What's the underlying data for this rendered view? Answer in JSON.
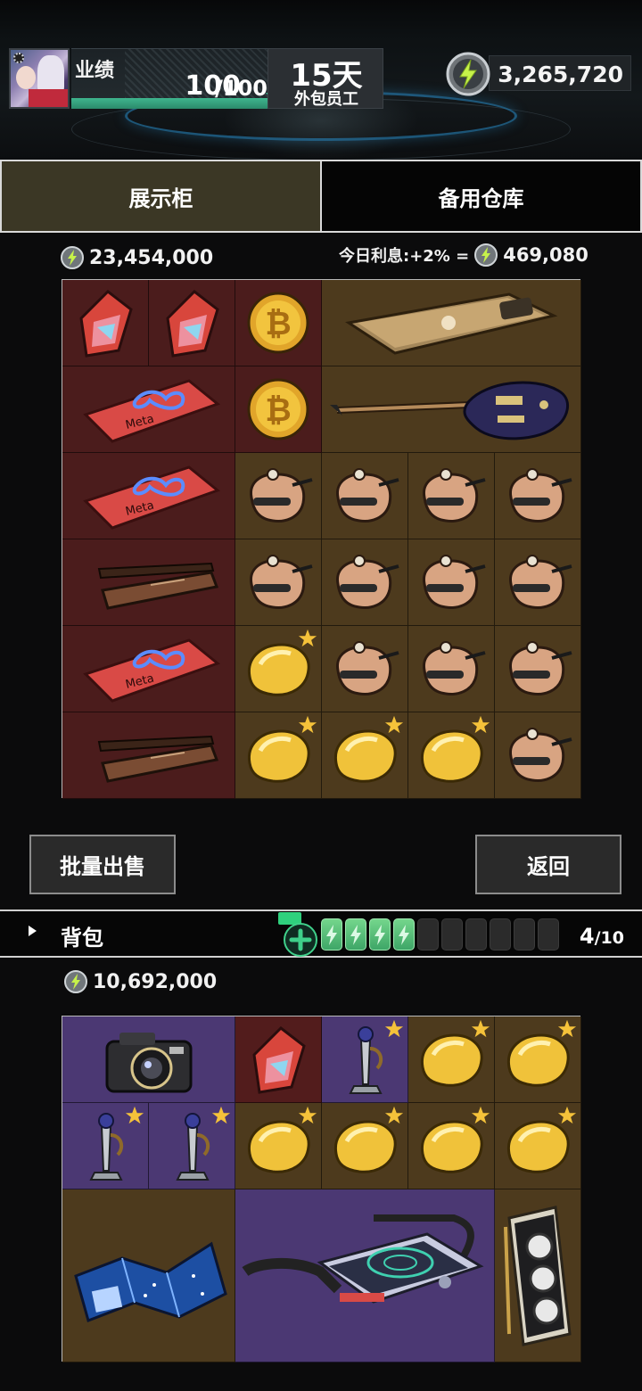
{
  "hud": {
    "performance_label": "业绩",
    "performance_value": "100",
    "performance_max": "/100",
    "performance_fraction": 1.0,
    "day_value": "15天",
    "day_sub": "外包员工",
    "money": "3,265,720"
  },
  "tabs": {
    "display": "展示柜",
    "storage": "备用仓库",
    "active": "display"
  },
  "display": {
    "value": "23,454,000",
    "interest_label": "今日利息:+2% =",
    "interest_value": "469,080"
  },
  "buttons": {
    "batch_sell": "批量出售",
    "back": "返回"
  },
  "backpack": {
    "title": "背包",
    "count": "4",
    "capacity": "/10",
    "energy_full": 4,
    "energy_empty": 6,
    "value": "10,692,000"
  },
  "colors": {
    "accent_green": "#3fb58e",
    "active_tab": "#3b3725",
    "cell_red": "#4b1c1c",
    "cell_brown": "#4d3a1d",
    "cell_purple": "#4b3873",
    "star": "#f5c23a"
  },
  "items": {
    "display_grid": [
      "crystal-shard",
      "crystal-shard",
      "bitcoin",
      "gold-phone",
      "property-deed",
      "bitcoin",
      "electric-guitar",
      "property-deed",
      "potato-sack",
      "potato-sack",
      "potato-sack",
      "potato-sack",
      "chopsticks-box",
      "potato-sack",
      "potato-sack",
      "potato-sack",
      "potato-sack",
      "property-deed",
      "gold-nugget-starred",
      "potato-sack",
      "potato-sack",
      "potato-sack",
      "chopsticks-box",
      "gold-nugget-starred",
      "gold-nugget-starred",
      "gold-nugget-starred",
      "potato-sack"
    ],
    "backpack_grid": [
      "camera",
      "crystal-shard",
      "trophy-starred",
      "gold-nugget-starred",
      "gold-nugget-starred",
      "trophy-starred",
      "trophy-starred",
      "gold-nugget-starred",
      "gold-nugget-starred",
      "gold-nugget-starred",
      "gold-nugget-starred",
      "star-map",
      "induction-cooker",
      "graphics-card"
    ]
  }
}
